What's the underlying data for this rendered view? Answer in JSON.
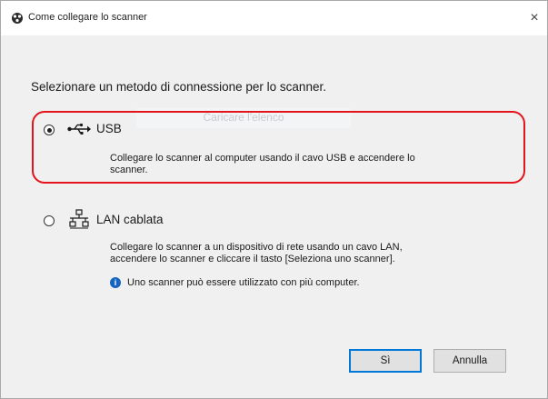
{
  "window": {
    "title": "Come collegare lo scanner",
    "close_glyph": "×"
  },
  "instruction": "Selezionare un metodo di connessione per lo scanner.",
  "options": [
    {
      "label": "USB",
      "selected": true,
      "icon": "usb-icon",
      "description_lines": [
        "Collegare lo scanner al computer usando il cavo USB e accendere lo",
        "scanner."
      ]
    },
    {
      "label": "LAN cablata",
      "selected": false,
      "icon": "network-icon",
      "description_lines": [
        "Collegare lo scanner a un dispositivo di rete usando un cavo LAN,",
        "accendere lo scanner e cliccare il tasto [Seleziona uno scanner]."
      ]
    }
  ],
  "ghost_text": "Caricare l'elenco",
  "info": {
    "icon": "info-icon",
    "text": "Uno scanner può essere utilizzato con più computer."
  },
  "buttons": {
    "yes": "Sì",
    "cancel": "Annulla"
  },
  "colors": {
    "highlight": "#e3141c",
    "accent": "#0078d7",
    "info": "#1565c0"
  }
}
